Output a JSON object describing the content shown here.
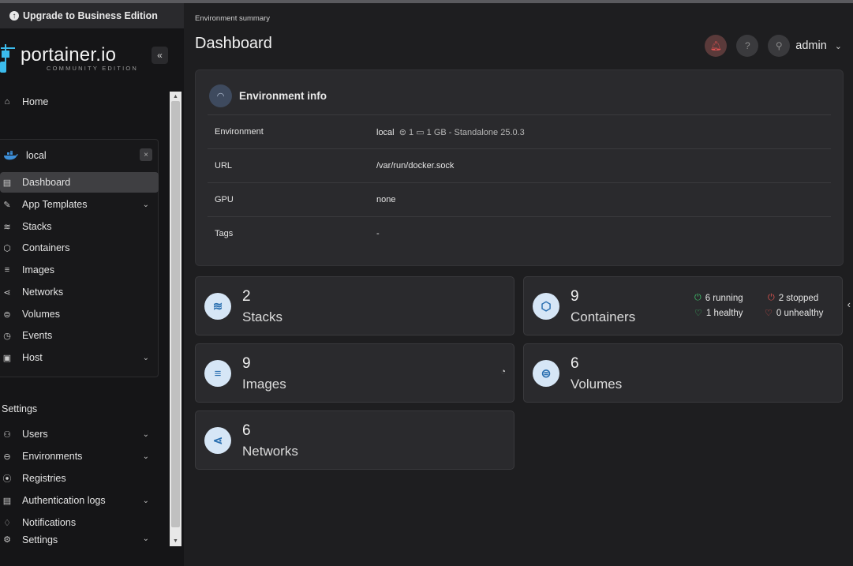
{
  "sidebar": {
    "upgrade_label": "Upgrade to Business Edition",
    "logo_text": "portainer.io",
    "logo_subtitle": "COMMUNITY EDITION",
    "collapse_icon": "«",
    "home_label": "Home",
    "environment": {
      "name": "local",
      "close": "×",
      "items": [
        {
          "label": "Dashboard",
          "icon": "dashboard-icon",
          "glyph": "▤"
        },
        {
          "label": "App Templates",
          "icon": "edit-icon",
          "glyph": "✎",
          "chevron": "⌄"
        },
        {
          "label": "Stacks",
          "icon": "layers-icon",
          "glyph": "≋"
        },
        {
          "label": "Containers",
          "icon": "box-icon",
          "glyph": "⬡"
        },
        {
          "label": "Images",
          "icon": "list-icon",
          "glyph": "≡"
        },
        {
          "label": "Networks",
          "icon": "share-icon",
          "glyph": "⋖"
        },
        {
          "label": "Volumes",
          "icon": "database-icon",
          "glyph": "⊜"
        },
        {
          "label": "Events",
          "icon": "clock-icon",
          "glyph": "◷"
        },
        {
          "label": "Host",
          "icon": "server-icon",
          "glyph": "▣",
          "chevron": "⌄"
        }
      ]
    },
    "settings_title": "Settings",
    "settings_items": [
      {
        "label": "Users",
        "icon": "users-icon",
        "glyph": "⚇",
        "chevron": "⌄"
      },
      {
        "label": "Environments",
        "icon": "plug-icon",
        "glyph": "⊖",
        "chevron": "⌄"
      },
      {
        "label": "Registries",
        "icon": "radio-icon",
        "glyph": "⦿"
      },
      {
        "label": "Authentication logs",
        "icon": "file-icon",
        "glyph": "▤",
        "chevron": "⌄"
      },
      {
        "label": "Notifications",
        "icon": "bell-icon",
        "glyph": "♫"
      },
      {
        "label": "Settings",
        "icon": "gear-icon",
        "glyph": "⚙",
        "chevron": "⌄"
      }
    ]
  },
  "header": {
    "breadcrumb": "Environment summary",
    "title": "Dashboard",
    "user": "admin"
  },
  "env_info": {
    "title": "Environment info",
    "rows": [
      {
        "key": "Environment",
        "value": "local",
        "extra": "⊜ 1 ▭ 1 GB - Standalone 25.0.3"
      },
      {
        "key": "URL",
        "value": "/var/run/docker.sock",
        "extra": ""
      },
      {
        "key": "GPU",
        "value": "none",
        "extra": ""
      },
      {
        "key": "Tags",
        "value": "-",
        "extra": ""
      }
    ]
  },
  "stats": {
    "stacks": {
      "count": "2",
      "label": "Stacks"
    },
    "containers": {
      "count": "9",
      "label": "Containers",
      "running": "6 running",
      "stopped": "2 stopped",
      "healthy": "1 healthy",
      "unhealthy": "0 unhealthy"
    },
    "images": {
      "count": "9",
      "label": "Images"
    },
    "volumes": {
      "count": "6",
      "label": "Volumes"
    },
    "networks": {
      "count": "6",
      "label": "Networks"
    }
  },
  "colors": {
    "accent": "#3d8fd8",
    "running": "#3fbf6a",
    "stopped": "#d9534f"
  }
}
